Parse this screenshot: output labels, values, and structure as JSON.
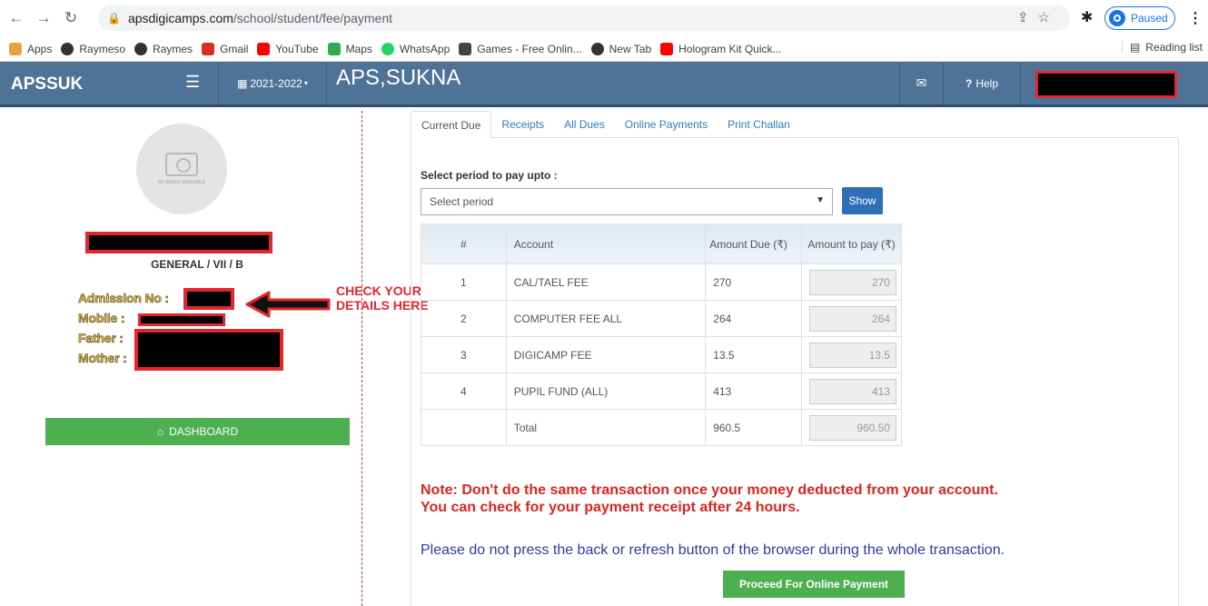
{
  "browser": {
    "url_host": "apsdigicamps.com",
    "url_path": "/school/student/fee/payment",
    "profile_status": "Paused",
    "bookmarks": [
      {
        "label": "Apps",
        "color": "#e8a33d"
      },
      {
        "label": "Raymeso",
        "color": "#333333"
      },
      {
        "label": "Raymes",
        "color": "#333333"
      },
      {
        "label": "Gmail",
        "color": "#d93025"
      },
      {
        "label": "YouTube",
        "color": "#ff0000"
      },
      {
        "label": "Maps",
        "color": "#34a853"
      },
      {
        "label": "WhatsApp",
        "color": "#25d366"
      },
      {
        "label": "Games - Free Onlin...",
        "color": "#444444"
      },
      {
        "label": "New Tab",
        "color": "#333333"
      },
      {
        "label": "Hologram Kit Quick...",
        "color": "#ff0000"
      }
    ],
    "reading_list": "Reading list"
  },
  "header": {
    "brand": "APSSUK",
    "year": "2021-2022",
    "school": "APS,SUKNA",
    "help": "Help"
  },
  "sidebar": {
    "photo_placeholder": "NO IMAGE AVAILABLE",
    "class_section": "GENERAL / VII / B",
    "admission_label": "Admission No :",
    "mobile_label": "Mobile :",
    "father_label": "Father :",
    "mother_label": "Mother :",
    "annotation": "CHECK YOUR DETAILS HERE",
    "dashboard_button": "DASHBOARD"
  },
  "tabs": [
    "Current Due",
    "Receipts",
    "All Dues",
    "Online Payments",
    "Print Challan"
  ],
  "form": {
    "period_label": "Select period to pay upto :",
    "period_value": "Select period",
    "show_button": "Show"
  },
  "table": {
    "headers": [
      "#",
      "Account",
      "Amount Due (₹)",
      "Amount to pay (₹)"
    ],
    "rows": [
      {
        "no": "1",
        "account": "CAL/TAEL FEE",
        "due": "270",
        "pay": "270"
      },
      {
        "no": "2",
        "account": "COMPUTER FEE ALL",
        "due": "264",
        "pay": "264"
      },
      {
        "no": "3",
        "account": "DIGICAMP FEE",
        "due": "13.5",
        "pay": "13.5"
      },
      {
        "no": "4",
        "account": "PUPIL FUND (ALL)",
        "due": "413",
        "pay": "413"
      }
    ],
    "total": {
      "label": "Total",
      "due": "960.5",
      "pay": "960.50"
    }
  },
  "note": {
    "line1": "Note: Don't do the same transaction once your money deducted from your account.",
    "line2": "You can check for your payment receipt after 24 hours."
  },
  "warning": "Please do not press the back or refresh button of the browser during the whole transaction.",
  "proceed_button": "Proceed For Online Payment"
}
